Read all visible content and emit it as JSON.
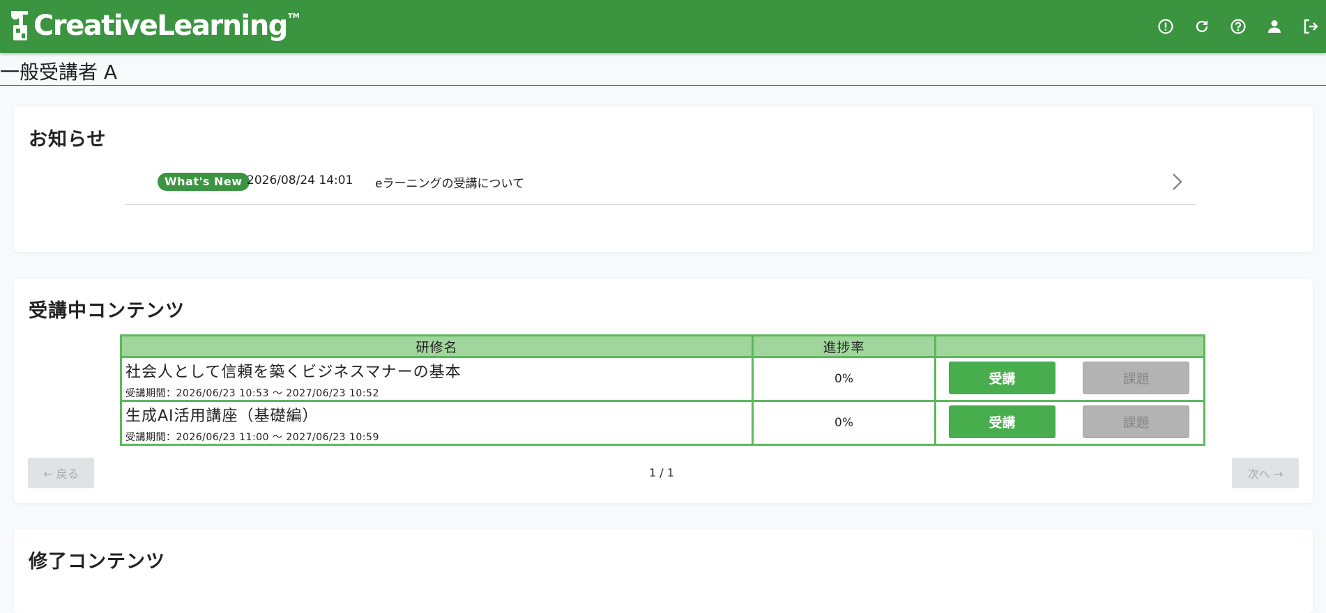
{
  "header": {
    "logo_text": "CreativeLearning",
    "logo_tm": "TM",
    "icons": [
      "alert-icon",
      "refresh-icon",
      "help-icon",
      "user-icon",
      "logout-icon"
    ]
  },
  "user": {
    "name": "一般受講者 A"
  },
  "news": {
    "title": "お知らせ",
    "items": [
      {
        "badge": "What's New",
        "date": "2026/08/24 14:01",
        "text": "eラーニングの受講について"
      }
    ]
  },
  "current": {
    "title": "受講中コンテンツ",
    "columns": [
      "研修名",
      "進捗率",
      ""
    ],
    "rows": [
      {
        "name": "社会人として信頼を築くビジネスマナーの基本",
        "period": "受講期間：2026/06/23 10:53 〜 2027/06/23 10:52",
        "progress": "0%",
        "take_label": "受講",
        "task_label": "課題"
      },
      {
        "name": "生成AI活用講座（基礎編）",
        "period": "受講期間：2026/06/23 11:00 〜 2027/06/23 10:59",
        "progress": "0%",
        "take_label": "受講",
        "task_label": "課題"
      }
    ],
    "pager": {
      "prev": "← 戻る",
      "label": "1 / 1",
      "next": "次へ →"
    }
  },
  "done": {
    "title": "修了コンテンツ"
  },
  "colors": {
    "brand": "#3a9440",
    "button": "#47ad4d",
    "table_border": "#5cb85c",
    "table_header": "#a0d59c"
  }
}
